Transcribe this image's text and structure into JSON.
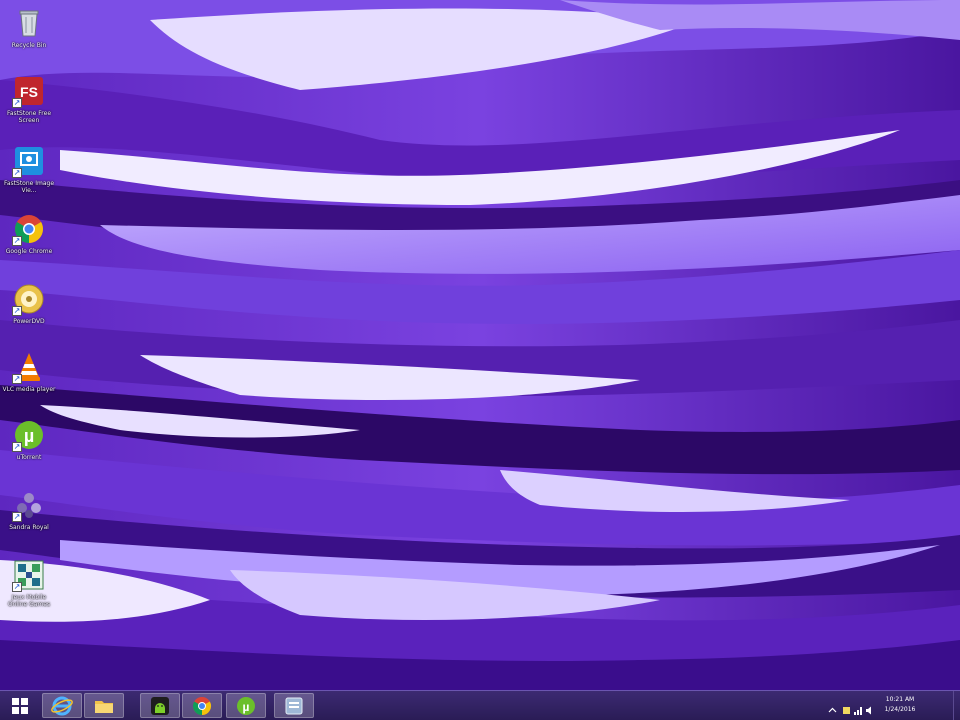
{
  "desktop": {
    "wallpaper_colors": [
      "#3c0d86",
      "#6a2fd0",
      "#9a6ff0",
      "#d9c9ff",
      "#f4efff"
    ],
    "icons": [
      {
        "label": "Recycle Bin",
        "icon": "recycle-bin-icon"
      },
      {
        "label": "FastStone Free Screen",
        "icon": "faststone-capture-icon"
      },
      {
        "label": "FastStone Image Vie...",
        "icon": "faststone-image-viewer-icon"
      },
      {
        "label": "Google Chrome",
        "icon": "chrome-icon"
      },
      {
        "label": "PowerDVD",
        "icon": "powerdvd-icon"
      },
      {
        "label": "VLC media player",
        "icon": "vlc-icon"
      },
      {
        "label": "uTorrent",
        "icon": "utorrent-icon"
      },
      {
        "label": "Sandra Royal",
        "icon": "sandra-icon"
      },
      {
        "label": "Jeux Mobile Online Games",
        "icon": "games-icon"
      }
    ]
  },
  "taskbar": {
    "items": [
      {
        "name": "start",
        "icon": "windows-logo-icon"
      },
      {
        "name": "internet-explorer",
        "icon": "internet-explorer-icon"
      },
      {
        "name": "file-explorer",
        "icon": "folder-icon"
      },
      {
        "name": "android-app",
        "icon": "android-icon"
      },
      {
        "name": "chrome",
        "icon": "chrome-icon"
      },
      {
        "name": "utorrent",
        "icon": "utorrent-icon"
      },
      {
        "name": "app",
        "icon": "app-icon"
      }
    ],
    "clock": {
      "time": "10:21 AM",
      "date": "1/24/2016"
    }
  }
}
